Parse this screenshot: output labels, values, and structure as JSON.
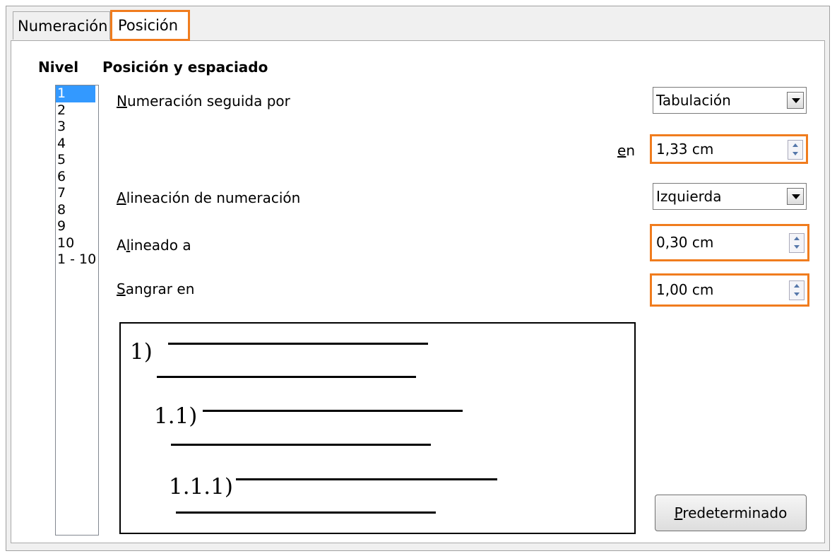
{
  "tabs": [
    {
      "label": "Numeración"
    },
    {
      "label": "Posición"
    }
  ],
  "nivel": {
    "header": "Nivel",
    "items": [
      "1",
      "2",
      "3",
      "4",
      "5",
      "6",
      "7",
      "8",
      "9",
      "10",
      "1 - 10"
    ],
    "selected": "1"
  },
  "position": {
    "header": "Posición y espaciado",
    "followed_by": {
      "label_u": "N",
      "label_rest": "umeración seguida por",
      "value": "Tabulación"
    },
    "tab_at": {
      "label_u": "e",
      "label_rest": "n",
      "value": "1,33 cm"
    },
    "alignment": {
      "label_u": "A",
      "label_rest": "lineación de numeración",
      "value": "Izquierda"
    },
    "aligned_at": {
      "label_pre": "A",
      "label_u": "l",
      "label_rest": "ineado a",
      "value": "0,30 cm"
    },
    "indent_at": {
      "label_u": "S",
      "label_rest": "angrar en",
      "value": "1,00 cm"
    }
  },
  "preview": {
    "levels": [
      "1)",
      "1.1)",
      "1.1.1)"
    ]
  },
  "default_button": {
    "label_u": "P",
    "label_rest": "redeterminado"
  },
  "colors": {
    "highlight": "#f07c1e",
    "selection": "#3399ff"
  }
}
